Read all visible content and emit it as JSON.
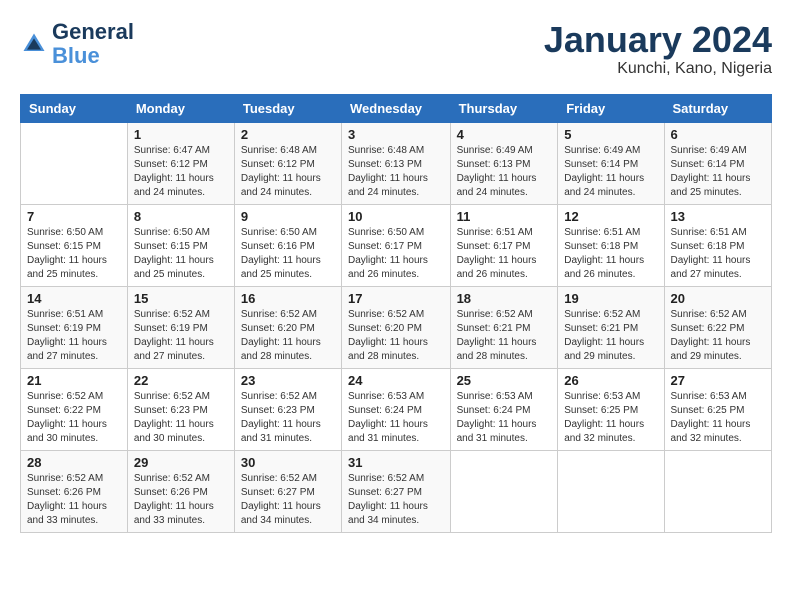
{
  "header": {
    "logo_line1": "General",
    "logo_line2": "Blue",
    "month": "January 2024",
    "location": "Kunchi, Kano, Nigeria"
  },
  "weekdays": [
    "Sunday",
    "Monday",
    "Tuesday",
    "Wednesday",
    "Thursday",
    "Friday",
    "Saturday"
  ],
  "weeks": [
    [
      {
        "day": "",
        "info": ""
      },
      {
        "day": "1",
        "info": "Sunrise: 6:47 AM\nSunset: 6:12 PM\nDaylight: 11 hours\nand 24 minutes."
      },
      {
        "day": "2",
        "info": "Sunrise: 6:48 AM\nSunset: 6:12 PM\nDaylight: 11 hours\nand 24 minutes."
      },
      {
        "day": "3",
        "info": "Sunrise: 6:48 AM\nSunset: 6:13 PM\nDaylight: 11 hours\nand 24 minutes."
      },
      {
        "day": "4",
        "info": "Sunrise: 6:49 AM\nSunset: 6:13 PM\nDaylight: 11 hours\nand 24 minutes."
      },
      {
        "day": "5",
        "info": "Sunrise: 6:49 AM\nSunset: 6:14 PM\nDaylight: 11 hours\nand 24 minutes."
      },
      {
        "day": "6",
        "info": "Sunrise: 6:49 AM\nSunset: 6:14 PM\nDaylight: 11 hours\nand 25 minutes."
      }
    ],
    [
      {
        "day": "7",
        "info": "Sunrise: 6:50 AM\nSunset: 6:15 PM\nDaylight: 11 hours\nand 25 minutes."
      },
      {
        "day": "8",
        "info": "Sunrise: 6:50 AM\nSunset: 6:15 PM\nDaylight: 11 hours\nand 25 minutes."
      },
      {
        "day": "9",
        "info": "Sunrise: 6:50 AM\nSunset: 6:16 PM\nDaylight: 11 hours\nand 25 minutes."
      },
      {
        "day": "10",
        "info": "Sunrise: 6:50 AM\nSunset: 6:17 PM\nDaylight: 11 hours\nand 26 minutes."
      },
      {
        "day": "11",
        "info": "Sunrise: 6:51 AM\nSunset: 6:17 PM\nDaylight: 11 hours\nand 26 minutes."
      },
      {
        "day": "12",
        "info": "Sunrise: 6:51 AM\nSunset: 6:18 PM\nDaylight: 11 hours\nand 26 minutes."
      },
      {
        "day": "13",
        "info": "Sunrise: 6:51 AM\nSunset: 6:18 PM\nDaylight: 11 hours\nand 27 minutes."
      }
    ],
    [
      {
        "day": "14",
        "info": "Sunrise: 6:51 AM\nSunset: 6:19 PM\nDaylight: 11 hours\nand 27 minutes."
      },
      {
        "day": "15",
        "info": "Sunrise: 6:52 AM\nSunset: 6:19 PM\nDaylight: 11 hours\nand 27 minutes."
      },
      {
        "day": "16",
        "info": "Sunrise: 6:52 AM\nSunset: 6:20 PM\nDaylight: 11 hours\nand 28 minutes."
      },
      {
        "day": "17",
        "info": "Sunrise: 6:52 AM\nSunset: 6:20 PM\nDaylight: 11 hours\nand 28 minutes."
      },
      {
        "day": "18",
        "info": "Sunrise: 6:52 AM\nSunset: 6:21 PM\nDaylight: 11 hours\nand 28 minutes."
      },
      {
        "day": "19",
        "info": "Sunrise: 6:52 AM\nSunset: 6:21 PM\nDaylight: 11 hours\nand 29 minutes."
      },
      {
        "day": "20",
        "info": "Sunrise: 6:52 AM\nSunset: 6:22 PM\nDaylight: 11 hours\nand 29 minutes."
      }
    ],
    [
      {
        "day": "21",
        "info": "Sunrise: 6:52 AM\nSunset: 6:22 PM\nDaylight: 11 hours\nand 30 minutes."
      },
      {
        "day": "22",
        "info": "Sunrise: 6:52 AM\nSunset: 6:23 PM\nDaylight: 11 hours\nand 30 minutes."
      },
      {
        "day": "23",
        "info": "Sunrise: 6:52 AM\nSunset: 6:23 PM\nDaylight: 11 hours\nand 31 minutes."
      },
      {
        "day": "24",
        "info": "Sunrise: 6:53 AM\nSunset: 6:24 PM\nDaylight: 11 hours\nand 31 minutes."
      },
      {
        "day": "25",
        "info": "Sunrise: 6:53 AM\nSunset: 6:24 PM\nDaylight: 11 hours\nand 31 minutes."
      },
      {
        "day": "26",
        "info": "Sunrise: 6:53 AM\nSunset: 6:25 PM\nDaylight: 11 hours\nand 32 minutes."
      },
      {
        "day": "27",
        "info": "Sunrise: 6:53 AM\nSunset: 6:25 PM\nDaylight: 11 hours\nand 32 minutes."
      }
    ],
    [
      {
        "day": "28",
        "info": "Sunrise: 6:52 AM\nSunset: 6:26 PM\nDaylight: 11 hours\nand 33 minutes."
      },
      {
        "day": "29",
        "info": "Sunrise: 6:52 AM\nSunset: 6:26 PM\nDaylight: 11 hours\nand 33 minutes."
      },
      {
        "day": "30",
        "info": "Sunrise: 6:52 AM\nSunset: 6:27 PM\nDaylight: 11 hours\nand 34 minutes."
      },
      {
        "day": "31",
        "info": "Sunrise: 6:52 AM\nSunset: 6:27 PM\nDaylight: 11 hours\nand 34 minutes."
      },
      {
        "day": "",
        "info": ""
      },
      {
        "day": "",
        "info": ""
      },
      {
        "day": "",
        "info": ""
      }
    ]
  ]
}
